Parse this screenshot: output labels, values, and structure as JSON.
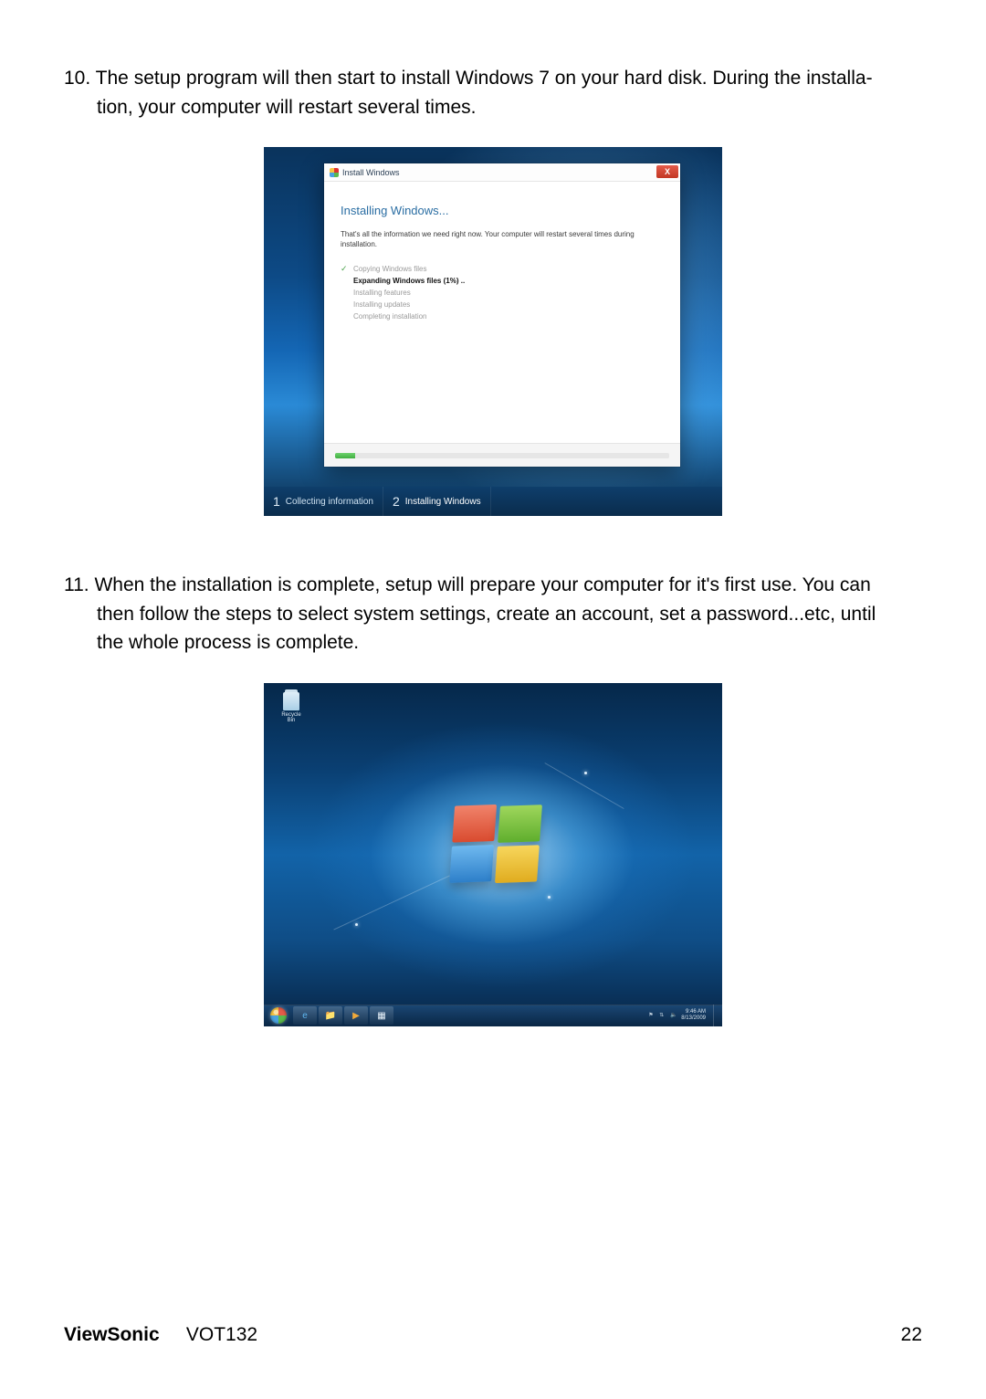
{
  "step10": {
    "num": "10.",
    "text_a": "The setup program will then start to install Windows 7 on your hard disk. During the installa-",
    "text_b": "tion, your computer will restart several times."
  },
  "wizard": {
    "title": "Install Windows",
    "close": "X",
    "heading": "Installing Windows...",
    "info": "That's all the information we need right now. Your computer will restart several times during installation.",
    "steps": {
      "s1": "Copying Windows files",
      "s2": "Expanding Windows files (1%) ..",
      "s3": "Installing features",
      "s4": "Installing updates",
      "s5": "Completing installation"
    },
    "footer": {
      "n1": "1",
      "l1": "Collecting information",
      "n2": "2",
      "l2": "Installing Windows"
    }
  },
  "step11": {
    "num": "11.",
    "text_a": "When the installation is complete, setup will prepare your computer for it's first use. You can",
    "text_b": "then follow the steps to select system settings, create an account, set a password...etc, until",
    "text_c": "the whole process is complete."
  },
  "desktop": {
    "recycle": "Recycle Bin",
    "clock_time": "9:46 AM",
    "clock_date": "8/13/2009"
  },
  "footer": {
    "brand": "ViewSonic",
    "model": "VOT132",
    "page": "22"
  }
}
